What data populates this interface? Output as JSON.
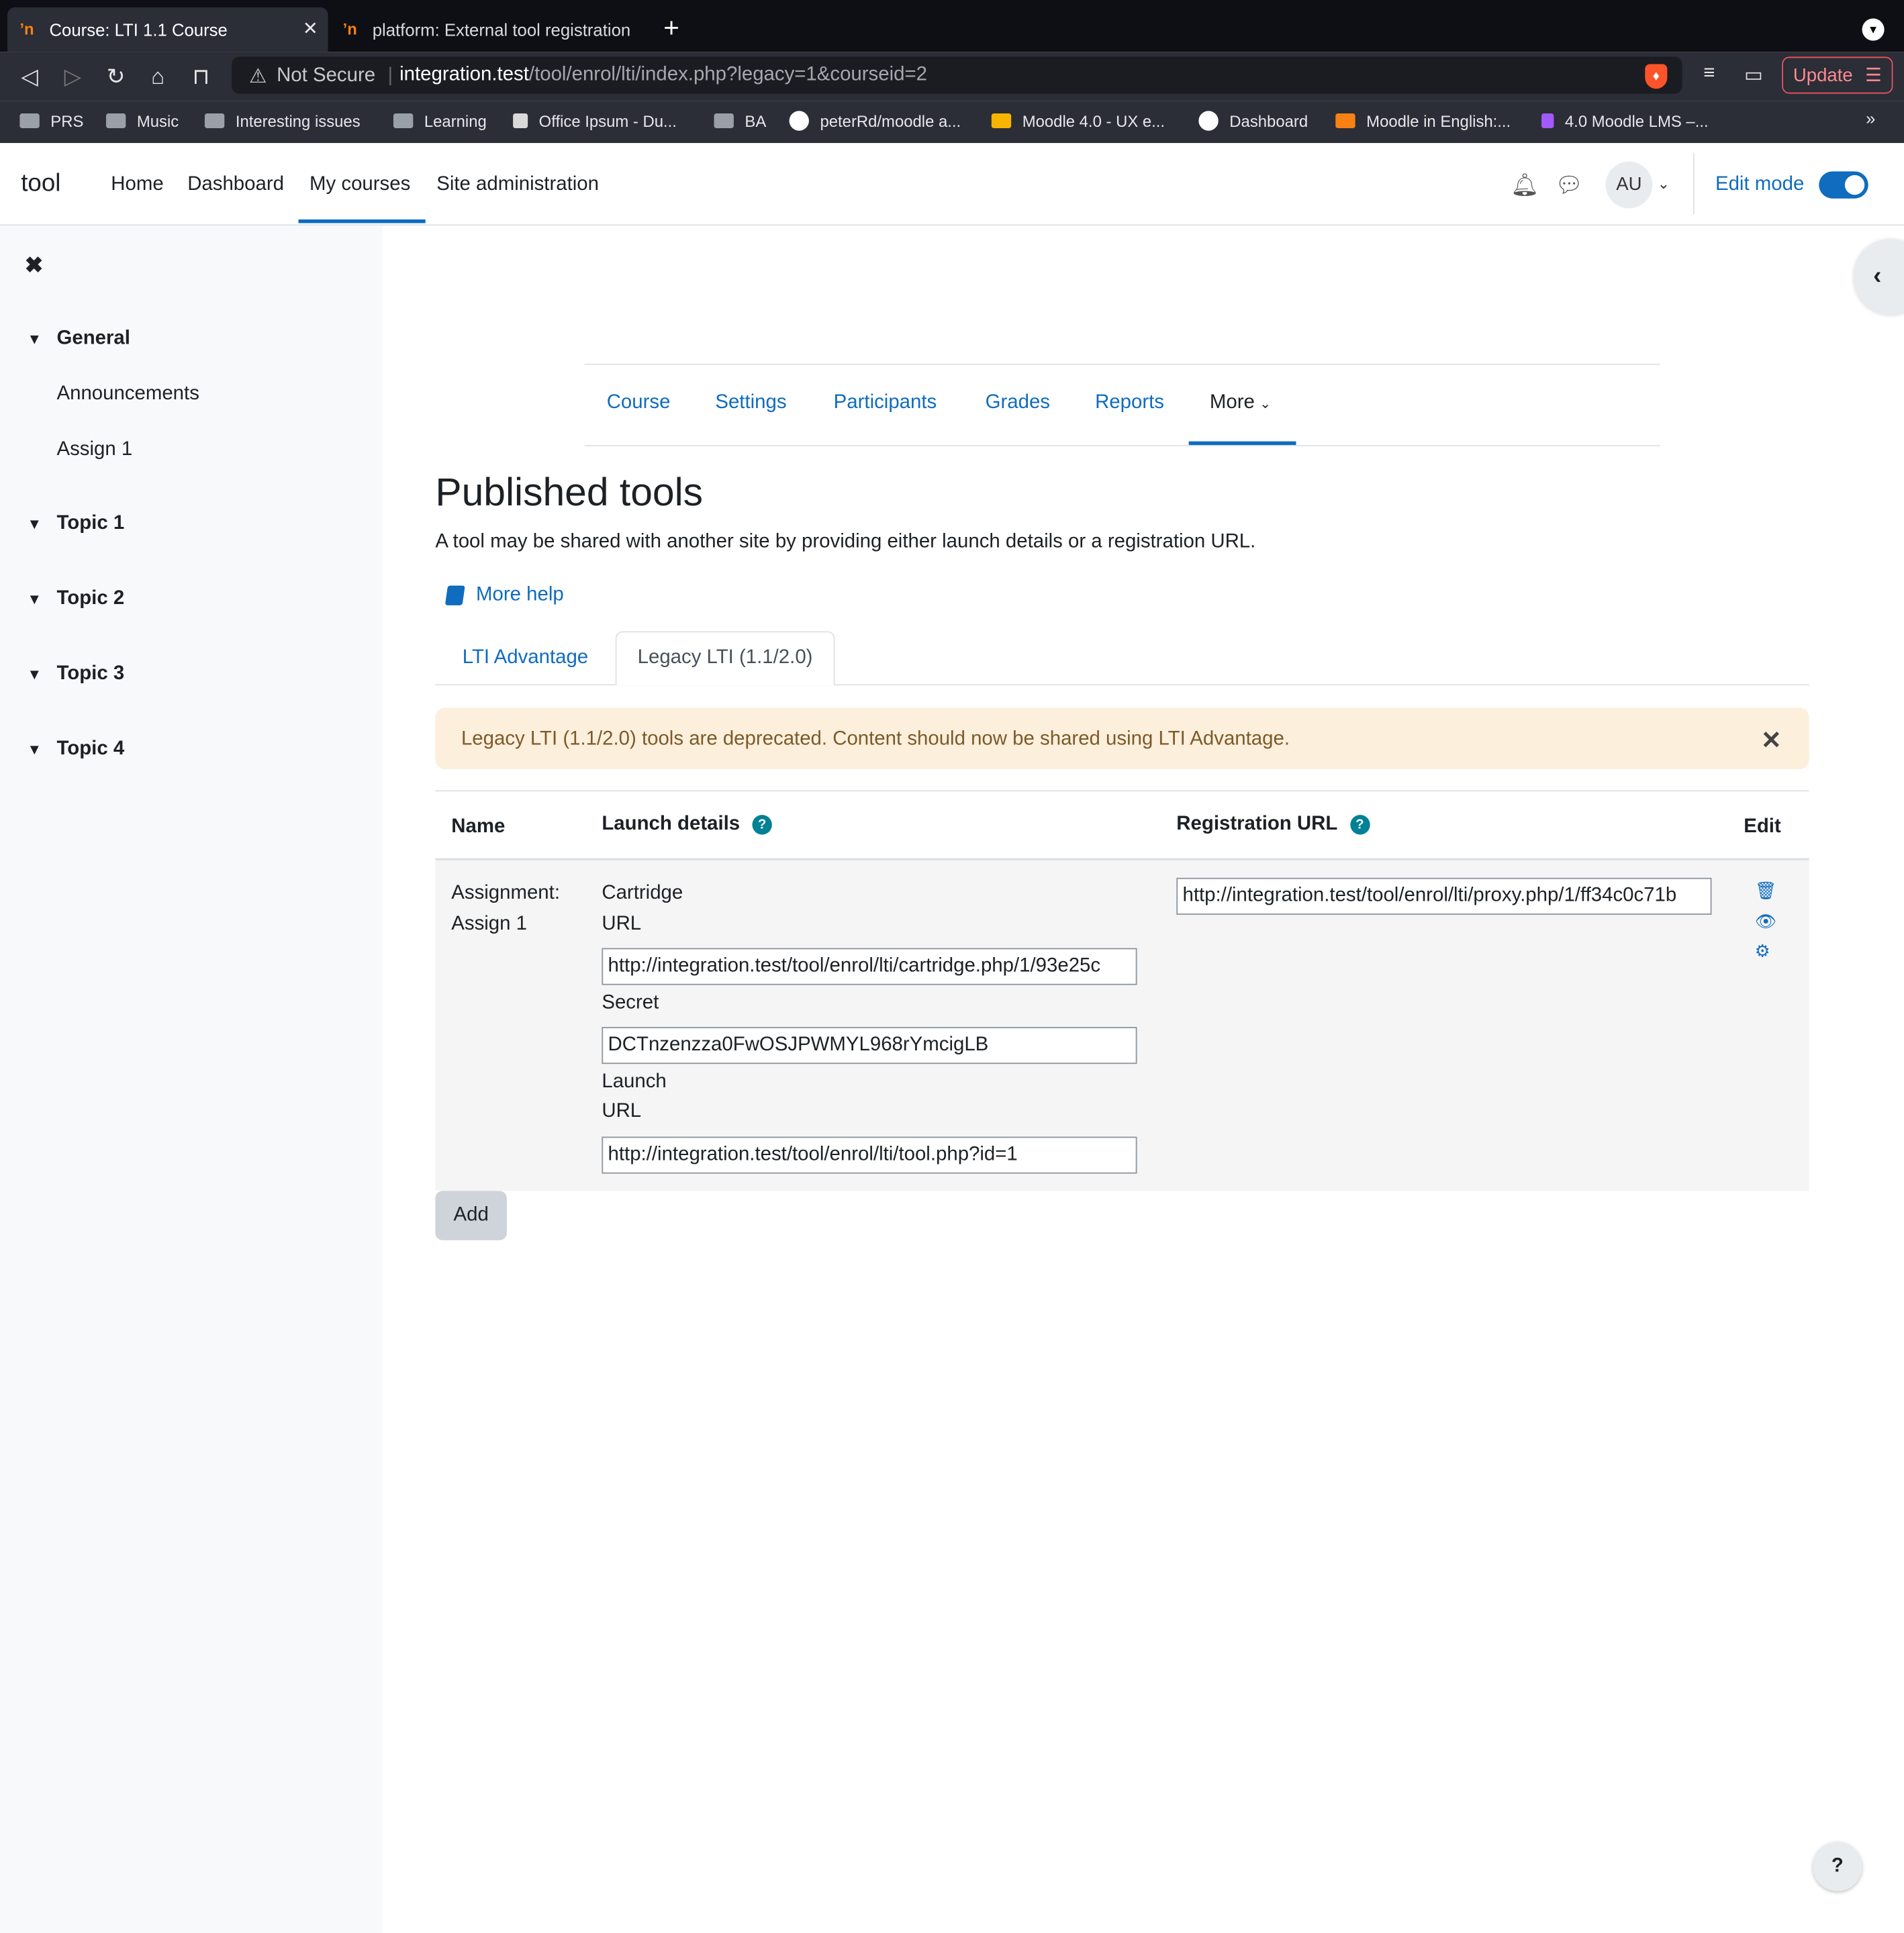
{
  "browser": {
    "tabs": [
      {
        "label": "Course: LTI 1.1 Course",
        "active": true
      },
      {
        "label": "platform: External tool registration",
        "active": false
      }
    ],
    "address": {
      "security": "Not Secure",
      "host": "integration.test",
      "path": "/tool/enrol/lti/index.php?legacy=1&courseid=2"
    },
    "update_label": "Update",
    "bookmarks": [
      "PRS",
      "Music",
      "Interesting issues",
      "Learning",
      "Office Ipsum - Du...",
      "BA",
      "peterRd/moodle a...",
      "Moodle 4.0 - UX e...",
      "Dashboard",
      "Moodle in English:...",
      "4.0 Moodle LMS –..."
    ],
    "bookmarks_more": "»"
  },
  "navbar": {
    "brand": "tool",
    "links": [
      "Home",
      "Dashboard",
      "My courses",
      "Site administration"
    ],
    "active_link": "My courses",
    "avatar": "AU",
    "edit_mode_label": "Edit mode",
    "edit_mode_on": true
  },
  "drawer": {
    "sections": [
      {
        "title": "General",
        "items": [
          "Announcements",
          "Assign 1"
        ]
      },
      {
        "title": "Topic 1",
        "items": []
      },
      {
        "title": "Topic 2",
        "items": []
      },
      {
        "title": "Topic 3",
        "items": []
      },
      {
        "title": "Topic 4",
        "items": []
      }
    ]
  },
  "secondary_nav": {
    "items": [
      "Course",
      "Settings",
      "Participants",
      "Grades",
      "Reports",
      "More"
    ],
    "active": "More"
  },
  "page": {
    "title": "Published tools",
    "intro": "A tool may be shared with another site by providing either launch details or a registration URL.",
    "help_link": "More help",
    "tabs": [
      "LTI Advantage",
      "Legacy LTI (1.1/2.0)"
    ],
    "active_tab": "Legacy LTI (1.1/2.0)",
    "alert": "Legacy LTI (1.1/2.0) tools are deprecated. Content should now be shared using LTI Advantage."
  },
  "table": {
    "headers": {
      "name": "Name",
      "launch": "Launch details",
      "registration": "Registration URL",
      "edit": "Edit"
    },
    "row": {
      "name_line1": "Assignment:",
      "name_line2": "Assign 1",
      "cartridge_label_1": "Cartridge",
      "cartridge_label_2": "URL",
      "cartridge_url": "http://integration.test/tool/enrol/lti/cartridge.php/1/93e25c",
      "secret_label": "Secret",
      "secret": "DCTnzenzza0FwOSJPWMYL968rYmcigLB",
      "launch_label_1": "Launch",
      "launch_label_2": "URL",
      "launch_url": "http://integration.test/tool/enrol/lti/tool.php?id=1",
      "registration_url": "http://integration.test/tool/enrol/lti/proxy.php/1/ff34c0c71b"
    }
  },
  "add_button": "Add",
  "help_fab": "?"
}
